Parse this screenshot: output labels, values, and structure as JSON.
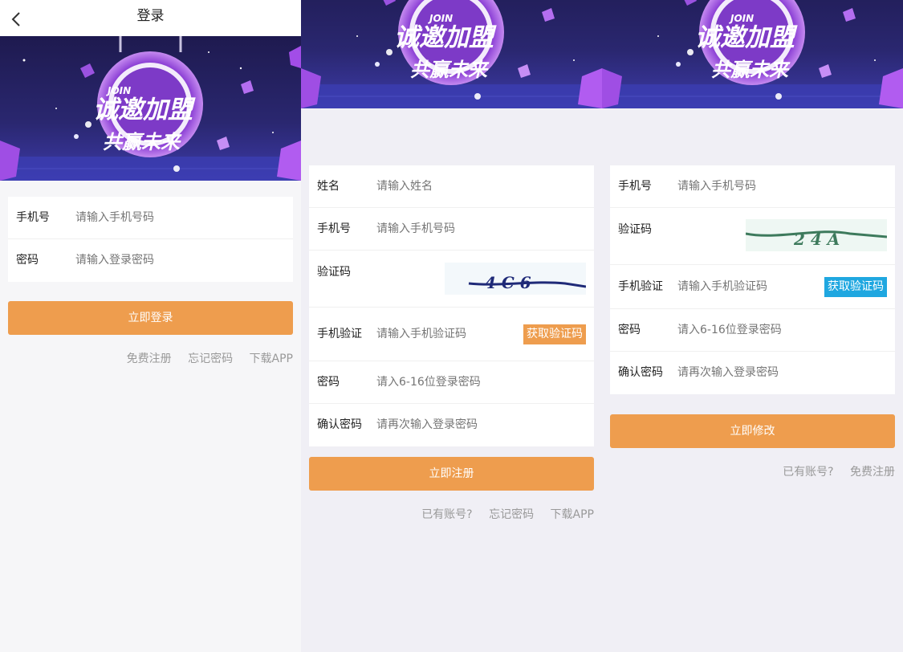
{
  "colors": {
    "primary_button": "#ee9d4e",
    "code_button_orange": "#ee9d4e",
    "code_button_blue": "#1fa7e0",
    "page_bg": "#f0eff5"
  },
  "banner": {
    "join": "JOIN",
    "line1": "诚邀加盟",
    "line2": "共赢未来"
  },
  "login": {
    "title": "登录",
    "phone_label": "手机号",
    "phone_placeholder": "请输入手机号码",
    "password_label": "密码",
    "password_placeholder": "请输入登录密码",
    "submit": "立即登录",
    "links": [
      "免费注册",
      "忘记密码",
      "下载APP"
    ]
  },
  "register": {
    "name_label": "姓名",
    "name_placeholder": "请输入姓名",
    "phone_label": "手机号",
    "phone_placeholder": "请输入手机号码",
    "captcha_label": "验证码",
    "captcha_text": "4 C 6",
    "sms_label": "手机验证",
    "sms_placeholder": "请输入手机验证码",
    "sms_button": "获取验证码",
    "password_label": "密码",
    "password_placeholder": "请入6-16位登录密码",
    "confirm_label": "确认密码",
    "confirm_placeholder": "请再次输入登录密码",
    "submit": "立即注册",
    "links": [
      "已有账号?",
      "忘记密码",
      "下载APP"
    ]
  },
  "reset": {
    "phone_label": "手机号",
    "phone_placeholder": "请输入手机号码",
    "captcha_label": "验证码",
    "captcha_text": "2 4 A",
    "sms_label": "手机验证",
    "sms_placeholder": "请输入手机验证码",
    "sms_button": "获取验证码",
    "password_label": "密码",
    "password_placeholder": "请入6-16位登录密码",
    "confirm_label": "确认密码",
    "confirm_placeholder": "请再次输入登录密码",
    "submit": "立即修改",
    "links": [
      "已有账号?",
      "免费注册"
    ]
  }
}
